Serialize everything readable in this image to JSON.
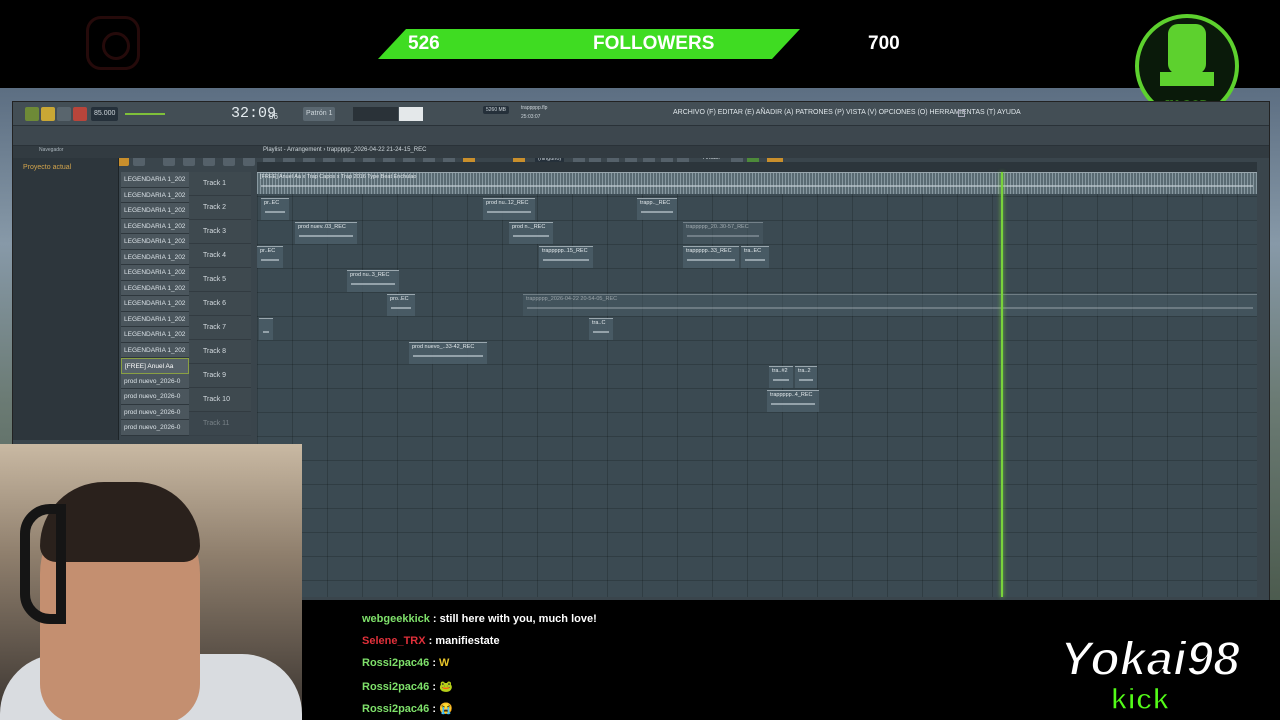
{
  "overlay": {
    "followers_current": "526",
    "followers_label": "FOLLOWERS",
    "followers_goal": "700",
    "emblem_text": "IN GOD WE TRUST",
    "streamer_name": "Yokai98",
    "platform": "kick"
  },
  "fl": {
    "tempo": "85.000",
    "time": "32:09",
    "time_small": "06",
    "pattern": "Patrón 1",
    "cpu_label": "5260 MB",
    "file_name": "trappppp.flp",
    "elapsed": "25:03:07",
    "menu": "ARCHIVO (F) EDITAR (E) AÑADIR (A) PATRONES (P) VISTA (V) OPCIONES (O) HERRAMIENTAS (T) AYUDA",
    "playlist_title": "Playlist - Arrangement › trappppp_2026-04-22 21-24-15_REC",
    "browser_title": "Navegador",
    "browser_item": "Proyecto actual",
    "add_label": "Añadir",
    "none_label": "(ninguno)"
  },
  "clip_list": [
    "LEGENDARIA 1_202",
    "LEGENDARIA 1_202",
    "LEGENDARIA 1_202",
    "LEGENDARIA 1_202",
    "LEGENDARIA 1_202",
    "LEGENDARIA 1_202",
    "LEGENDARIA 1_202",
    "LEGENDARIA 1_202",
    "LEGENDARIA 1_202",
    "LEGENDARIA 1_202",
    "LEGENDARIA 1_202",
    "LEGENDARIA 1_202",
    "[FREE] Anuel Aa",
    "prod nuevo_2026-0",
    "prod nuevo_2026-0",
    "prod nuevo_2026-0",
    "prod nuevo_2026-0"
  ],
  "tracks": [
    "Track 1",
    "Track 2",
    "Track 3",
    "Track 4",
    "Track 5",
    "Track 6",
    "Track 7",
    "Track 8",
    "Track 9",
    "Track 10",
    "Track 11"
  ],
  "clips": {
    "track1": "[FREE] Anuel Aa x Trap Capos x Trap 2016 Type Beat Enchulao",
    "c2a": "pr..EC",
    "c2b": "prod nu..12_REC",
    "c2c": "trapp.._REC",
    "c3a": "prod nuev..03_REC",
    "c3b": "prod n.._REC",
    "c3c": "trappppp_20..30-57_REC",
    "c4a": "pr..EC",
    "c4b": "trappppp..15_REC",
    "c4c": "trappppp..33_REC",
    "c4d": "tra..EC",
    "c5a": "prod nu..3_REC",
    "c6a": "pro..EC",
    "c6b": "trappppp_2026-04-22 20-54-05_REC",
    "c7b": "tra..C",
    "c8a": "prod nuevo_..33-42_REC",
    "c9a": "tra..#2",
    "c9b": "tra..2",
    "c10a": "trappppp..4_REC"
  },
  "chat": [
    {
      "user": "webgeekkick",
      "color": "#7ee06a",
      "text": "still here with you, much love!"
    },
    {
      "user": "Selene_TRX",
      "color": "#e0303a",
      "text": "manifiestate"
    },
    {
      "user": "Rossi2pac46",
      "color": "#7ee06a",
      "text": "W"
    },
    {
      "user": "Rossi2pac46",
      "color": "#7ee06a",
      "text": "🐸"
    },
    {
      "user": "Rossi2pac46",
      "color": "#7ee06a",
      "text": "😭"
    }
  ]
}
